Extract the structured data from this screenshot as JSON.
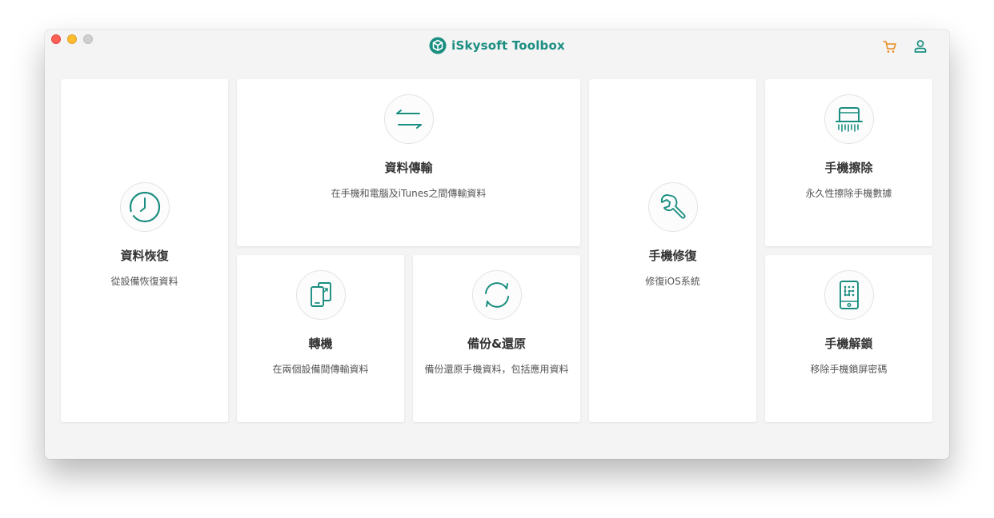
{
  "app": {
    "title": "iSkysoft Toolbox"
  },
  "colors": {
    "brand": "#1a8e80",
    "accent": "#e98a1a"
  },
  "header": {
    "icons": [
      "cart-icon",
      "user-icon"
    ]
  },
  "cards": [
    {
      "key": "data-recovery",
      "title": "資料恢復",
      "desc": "從設備恢復資料",
      "icon": "clock-icon"
    },
    {
      "key": "data-transfer",
      "title": "資料傳輸",
      "desc": "在手機和電腦及iTunes之間傳輸資料",
      "icon": "transfer-arrows-icon"
    },
    {
      "key": "phone-repair",
      "title": "手機修復",
      "desc": "修復iOS系統",
      "icon": "wrench-icon"
    },
    {
      "key": "phone-erase",
      "title": "手機擦除",
      "desc": "永久性擦除手機數據",
      "icon": "shredder-icon"
    },
    {
      "key": "phone-switch",
      "title": "轉機",
      "desc": "在兩個設備間傳輸資料",
      "icon": "phone-to-phone-icon"
    },
    {
      "key": "backup-restore",
      "title": "備份&還原",
      "desc": "備份還原手機資料，包括應用資料",
      "icon": "sync-icon"
    },
    {
      "key": "phone-unlock",
      "title": "手機解鎖",
      "desc": "移除手機鎖屏密碼",
      "icon": "phone-lock-icon"
    }
  ]
}
